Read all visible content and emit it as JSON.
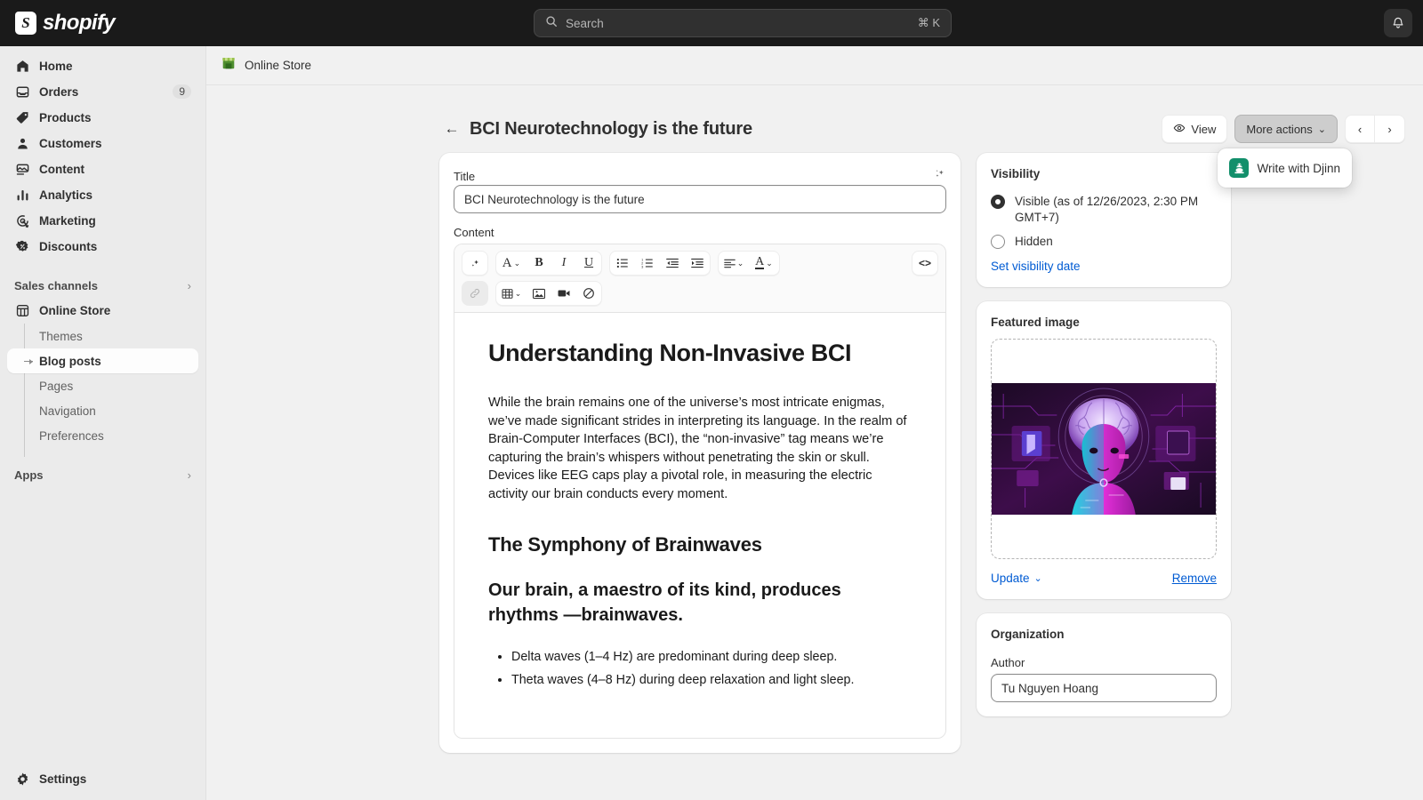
{
  "topbar": {
    "brand_mark": "S",
    "brand_word": "shopify",
    "search": {
      "placeholder": "Search",
      "shortcut": "⌘ K",
      "icon": "search-icon"
    },
    "notifications_icon": "bell-icon"
  },
  "sidebar": {
    "items": [
      {
        "label": "Home",
        "icon": "home-icon",
        "badge": ""
      },
      {
        "label": "Orders",
        "icon": "orders-icon",
        "badge": "9"
      },
      {
        "label": "Products",
        "icon": "products-tag-icon",
        "badge": ""
      },
      {
        "label": "Customers",
        "icon": "customers-icon",
        "badge": ""
      },
      {
        "label": "Content",
        "icon": "content-image-icon",
        "badge": ""
      },
      {
        "label": "Analytics",
        "icon": "analytics-bars-icon",
        "badge": ""
      },
      {
        "label": "Marketing",
        "icon": "marketing-target-icon",
        "badge": ""
      },
      {
        "label": "Discounts",
        "icon": "discounts-icon",
        "badge": ""
      }
    ],
    "sales_channels": {
      "label": "Sales channels",
      "chevron": "›"
    },
    "online_store": {
      "label": "Online Store",
      "icon": "storefront-icon"
    },
    "sub_items": [
      {
        "label": "Themes",
        "active": false
      },
      {
        "label": "Blog posts",
        "active": true
      },
      {
        "label": "Pages",
        "active": false
      },
      {
        "label": "Navigation",
        "active": false
      },
      {
        "label": "Preferences",
        "active": false
      }
    ],
    "apps": {
      "label": "Apps",
      "chevron": "›"
    },
    "settings": {
      "label": "Settings",
      "icon": "gear-icon"
    }
  },
  "breadcrumb": {
    "label": "Online Store",
    "icon": "storefront-icon"
  },
  "header": {
    "back_icon": "arrow-left-icon",
    "title": "BCI Neurotechnology is the future",
    "view_label": "View",
    "view_icon": "eye-icon",
    "more_actions_label": "More actions",
    "more_actions_chevron": "⌄",
    "prev_icon": "chevron-left-icon",
    "next_icon": "chevron-right-icon"
  },
  "more_actions_menu": {
    "items": [
      {
        "label": "Write with Djinn",
        "icon": "djinn-icon",
        "icon_color": "#128f6b"
      }
    ]
  },
  "post_form": {
    "title_label": "Title",
    "title_value": "BCI Neurotechnology is the future",
    "title_magic_icon": "sparkle-icon",
    "content_label": "Content"
  },
  "editor_toolbar": {
    "row1": [
      {
        "name": "magic-write-button",
        "glyph": "✧"
      },
      {
        "name": "font-style-dropdown",
        "glyph": "A",
        "chevron": "⌄"
      },
      {
        "name": "bold-button",
        "glyph": "B"
      },
      {
        "name": "italic-button",
        "glyph": "I"
      },
      {
        "name": "underline-button",
        "glyph": "U"
      },
      {
        "name": "bulleted-list-button",
        "glyph": "☰"
      },
      {
        "name": "numbered-list-button",
        "glyph": "☰"
      },
      {
        "name": "outdent-button",
        "glyph": "⇤"
      },
      {
        "name": "indent-button",
        "glyph": "⇥"
      },
      {
        "name": "align-dropdown",
        "glyph": "≡",
        "chevron": "⌄"
      },
      {
        "name": "text-color-dropdown",
        "glyph": "A",
        "chevron": "⌄"
      },
      {
        "name": "code-view-button",
        "glyph": "<>"
      }
    ],
    "row2": [
      {
        "name": "insert-link-button",
        "glyph": "🔗",
        "disabled": true
      },
      {
        "name": "insert-table-dropdown",
        "glyph": "▦",
        "chevron": "⌄"
      },
      {
        "name": "insert-image-button",
        "glyph": "🖼"
      },
      {
        "name": "insert-video-button",
        "glyph": "🎥"
      },
      {
        "name": "clear-formatting-button",
        "glyph": "⊘"
      }
    ]
  },
  "content_body": {
    "heading1": "Understanding Non-Invasive BCI",
    "paragraph1": "While the brain remains one of the universe’s most intricate enigmas, we’ve made significant strides in interpreting its language. In the realm of Brain-Computer Interfaces (BCI), the “non-invasive” tag means we’re capturing the brain’s whispers without penetrating the skin or skull. Devices like EEG caps play a pivotal role, in measuring the electric activity our brain conducts every moment.",
    "heading2": "The Symphony of Brainwaves",
    "lead": "Our brain, a maestro of its kind, produces rhythms —brainwaves.",
    "bullets": [
      "Delta waves (1–4 Hz) are predominant during deep sleep.",
      "Theta waves (4–8 Hz) during deep relaxation and light sleep."
    ]
  },
  "visibility": {
    "card_title": "Visibility",
    "options": [
      {
        "label": "Visible (as of 12/26/2023, 2:30 PM GMT+7)",
        "selected": true
      },
      {
        "label": "Hidden",
        "selected": false
      }
    ],
    "set_date_link": "Set visibility date"
  },
  "featured_image": {
    "card_title": "Featured image",
    "alt": "Neon purple and cyan AI portrait of a woman with a glowing brain and circuitry",
    "update_label": "Update",
    "update_chevron": "⌄",
    "remove_label": "Remove"
  },
  "organization": {
    "card_title": "Organization",
    "author_label": "Author",
    "author_value": "Tu Nguyen Hoang"
  },
  "colors": {
    "topbar_bg": "#1a1a1a",
    "sidebar_bg": "#ebebeb",
    "page_bg": "#f1f1f1",
    "link_blue": "#005bd3",
    "djinn_green": "#128f6b"
  }
}
